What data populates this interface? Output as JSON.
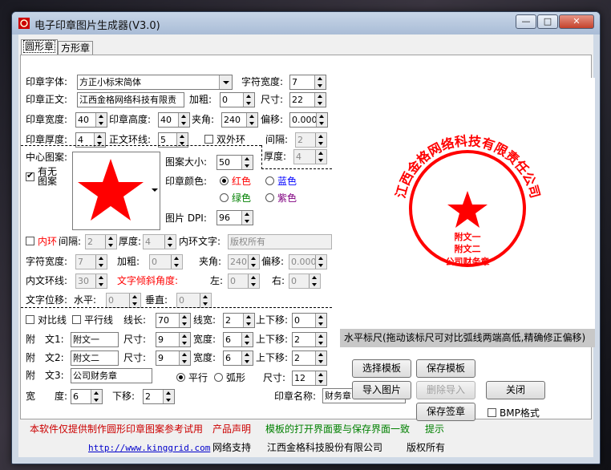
{
  "window": {
    "title": "电子印章图片生成器(V3.0)",
    "min": "—",
    "max": "□",
    "close": "✕"
  },
  "tabs": [
    "圆形章",
    "方形章"
  ],
  "form": {
    "font_label": "印章字体:",
    "font_value": "方正小标宋简体",
    "char_width_label": "字符宽度:",
    "char_width": "7",
    "text_label": "印章正文:",
    "text_value": "江西金格网络科技有限责",
    "bold_label": "加粗:",
    "bold": "0",
    "size_label": "尺寸:",
    "size": "22",
    "width_label": "印章宽度:",
    "width": "40",
    "height_label": "印章高度:",
    "height": "40",
    "angle_label": "夹角:",
    "angle": "240",
    "offset_label": "偏移:",
    "offset": "0.000",
    "thickness_label": "印章厚度:",
    "thickness": "4",
    "ring_label": "正文环线:",
    "ring": "5",
    "double_ring_label": "双外环",
    "gap_label": "间隔:",
    "gap": "2",
    "center_label": "中心图案:",
    "has_pattern_label": "有无图案",
    "inner_thickness_label": "厚度:",
    "inner_thickness": "4",
    "pattern_size_label": "图案大小:",
    "pattern_size": "50",
    "color_label": "印章颜色:",
    "colors": [
      "红色",
      "蓝色",
      "绿色",
      "紫色"
    ],
    "dpi_label": "图片 DPI:",
    "dpi": "96",
    "inner_ring_label": "内环",
    "inner_gap_label": "间隔:",
    "inner_gap": "2",
    "inner_thick_label": "厚度:",
    "inner_thick": "4",
    "inner_text_label": "内环文字:",
    "inner_text": "版权所有",
    "c2_width_label": "字符宽度:",
    "c2_width": "7",
    "c2_bold_label": "加粗:",
    "c2_bold": "0",
    "c2_angle_label": "夹角:",
    "c2_angle": "240",
    "c2_offset_label": "偏移:",
    "c2_offset": "0.000",
    "inner_ring_line_label": "内文环线:",
    "inner_ring_line": "30",
    "tilt_label": "文字倾斜角度:",
    "left_label": "左:",
    "left": "0",
    "right_label": "右:",
    "right": "0",
    "shift_label": "文字位移:",
    "hshift_label": "水平:",
    "hshift": "0",
    "vshift_label": "垂直:",
    "vshift": "0",
    "contrast_label": "对比线",
    "parallel_label": "平行线",
    "linelen_label": "线长:",
    "linelen": "70",
    "linewidth_label": "线宽:",
    "linewidth": "2",
    "linemove_label": "上下移:",
    "linemove": "0",
    "a1_label": "附　文1:",
    "a1": "附文一",
    "a1_size_label": "尺寸:",
    "a1_size": "9",
    "a1_w_label": "宽度:",
    "a1_w": "6",
    "a1_move_label": "上下移:",
    "a1_move": "2",
    "a2_label": "附　文2:",
    "a2": "附文二",
    "a2_size_label": "尺寸:",
    "a2_size": "9",
    "a2_w_label": "宽度:",
    "a2_w": "6",
    "a2_move_label": "上下移:",
    "a2_move": "2",
    "a3_label": "附　文3:",
    "a3": "公司财务章",
    "flat_label": "平行",
    "arc_label": "弧形",
    "a3_size_label": "尺寸:",
    "a3_size": "12",
    "w_label": "宽　　度:",
    "w": "6",
    "down_label": "下移:",
    "down": "2",
    "name_label": "印章名称:",
    "name": "财务章"
  },
  "ruler_text": "水平标尺(拖动该标尺可对比弧线两端高低,精确修正偏移)",
  "buttons": {
    "select_tpl": "选择模板",
    "save_tpl": "保存模板",
    "import_img": "导入图片",
    "delete_import": "删除导入",
    "close": "关闭",
    "save_seal": "保存签章",
    "bmp": "BMP格式"
  },
  "seal": {
    "ring_text": "江西金格网络科技有限责任公司",
    "attach1": "附文一",
    "attach2": "附文二",
    "attach3": "公司财务章",
    "color": "#ff0000"
  },
  "footer": {
    "notice": "本软件仅提供制作圆形印章图案参考试用",
    "statement": "产品声明",
    "template_note": "模板的打开界面要与保存界面一致",
    "hint": "提示",
    "url": "http://www.kinggrid.com",
    "support": "网络支持",
    "company": "江西金格科技股份有限公司",
    "rights": "版权所有"
  }
}
